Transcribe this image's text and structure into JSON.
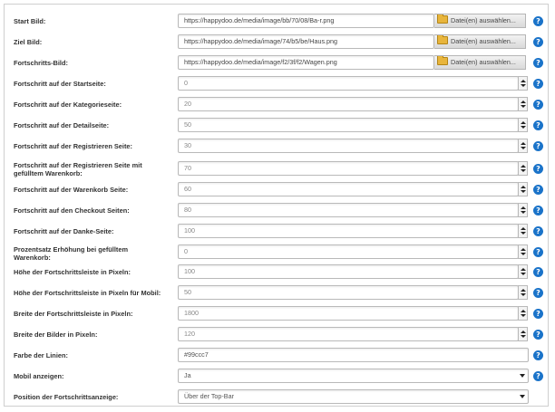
{
  "icons": {
    "help": "help-circle-icon",
    "folder": "folder-icon",
    "spinner": "spinner-arrows-icon",
    "dropdown": "chevron-down-icon"
  },
  "colors": {
    "help_icon": "#1a73c9"
  },
  "file_button_label": "Datei(en) auswählen...",
  "help_glyph": "?",
  "file_fields": [
    {
      "label": "Start Bild:",
      "value": "https://happydoo.de/media/image/bb/70/08/Ba-r.png"
    },
    {
      "label": "Ziel Bild:",
      "value": "https://happydoo.de/media/image/74/b5/be/Haus.png"
    },
    {
      "label": "Fortschritts-Bild:",
      "value": "https://happydoo.de/media/image/f2/3f/f2/Wagen.png"
    }
  ],
  "number_fields": [
    {
      "label": "Fortschritt auf der Startseite:",
      "value": "0"
    },
    {
      "label": "Fortschritt auf der Kategorieseite:",
      "value": "20"
    },
    {
      "label": "Fortschritt auf der Detailseite:",
      "value": "50"
    },
    {
      "label": "Fortschritt auf der Registrieren Seite:",
      "value": "30"
    },
    {
      "label": "Fortschritt auf der Registrieren Seite mit gefülltem Warenkorb:",
      "value": "70"
    },
    {
      "label": "Fortschritt auf der Warenkorb Seite:",
      "value": "60"
    },
    {
      "label": "Fortschritt auf den Checkout Seiten:",
      "value": "80"
    },
    {
      "label": "Fortschritt auf der Danke-Seite:",
      "value": "100"
    },
    {
      "label": "Prozentsatz Erhöhung bei gefülltem Warenkorb:",
      "value": "0"
    },
    {
      "label": "Höhe der Fortschrittsleiste in Pixeln:",
      "value": "100"
    },
    {
      "label": "Höhe der Fortschrittsleiste in Pixeln für Mobil:",
      "value": "50"
    },
    {
      "label": "Breite der Fortschrittsleiste in Pixeln:",
      "value": "1800"
    },
    {
      "label": "Breite der Bilder in Pixeln:",
      "value": "120"
    }
  ],
  "color_field": {
    "label": "Farbe der Linien:",
    "value": "#99ccc7"
  },
  "mobile_select": {
    "label": "Mobil anzeigen:",
    "value": "Ja"
  },
  "position_select": {
    "label": "Position der Fortschrittsanzeige:",
    "value": "Über der Top-Bar"
  }
}
